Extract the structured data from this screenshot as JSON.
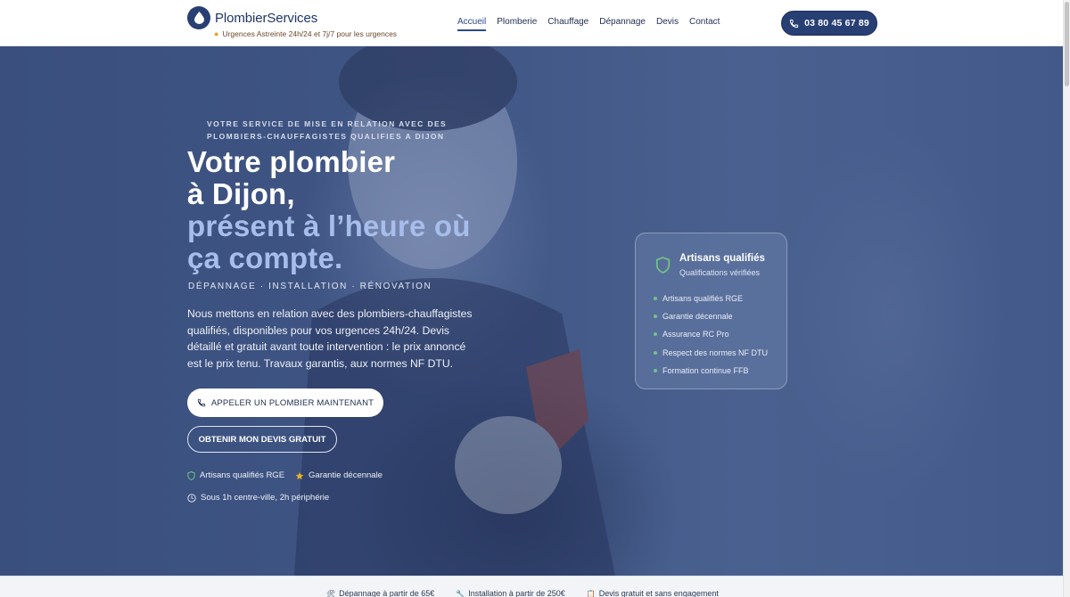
{
  "header": {
    "brand": "PlombierServices",
    "urgence": "Urgences Astreinte 24h/24 et 7j/7 pour les urgences",
    "nav": [
      {
        "label": "Accueil",
        "active": true
      },
      {
        "label": "Plomberie",
        "active": false
      },
      {
        "label": "Chauffage",
        "active": false
      },
      {
        "label": "Dépannage",
        "active": false
      },
      {
        "label": "Devis",
        "active": false
      },
      {
        "label": "Contact",
        "active": false
      }
    ],
    "phone": "03 80 45 67 89"
  },
  "hero": {
    "kicker": "VOTRE SERVICE DE MISE EN RELATION AVEC DES PLOMBIERS-CHAUFFAGISTES QUALIFIES A DIJON",
    "title_line1": "Votre plombier",
    "title_line2": "à Dijon,",
    "title_accent1": "présent à l’heure où",
    "title_accent2": "ça compte.",
    "services": "DÉPANNAGE · INSTALLATION · RÉNOVATION",
    "lead": "Nous mettons en relation avec des plombiers-chauffagistes qualifiés, disponibles pour vos urgences 24h/24. Devis détaillé et gratuit avant toute intervention : le prix annoncé est le prix tenu. Travaux garantis, aux normes NF DTU.",
    "cta_call": "APPELER UN PLOMBIER MAINTENANT",
    "cta_quote": "OBTENIR MON DEVIS GRATUIT",
    "badge_rge": "Artisans qualifiés RGE",
    "badge_garantie": "Garantie décennale",
    "delay": "Sous 1h centre-ville, 2h périphérie"
  },
  "card": {
    "title": "Artisans qualifiés",
    "subtitle": "Qualifications vérifiées",
    "items": [
      "Artisans qualifiés RGE",
      "Garantie décennale",
      "Assurance RC Pro",
      "Respect des normes NF DTU",
      "Formation continue FFB"
    ]
  },
  "strip": {
    "items": [
      "Dépannage à partir de 65€",
      "Installation à partir de 250€",
      "Devis gratuit et sans engagement"
    ]
  },
  "colors": {
    "brand": "#283f74",
    "accent_text": "#a7bdea",
    "check_green": "#71c487",
    "star": "#e6b422"
  }
}
